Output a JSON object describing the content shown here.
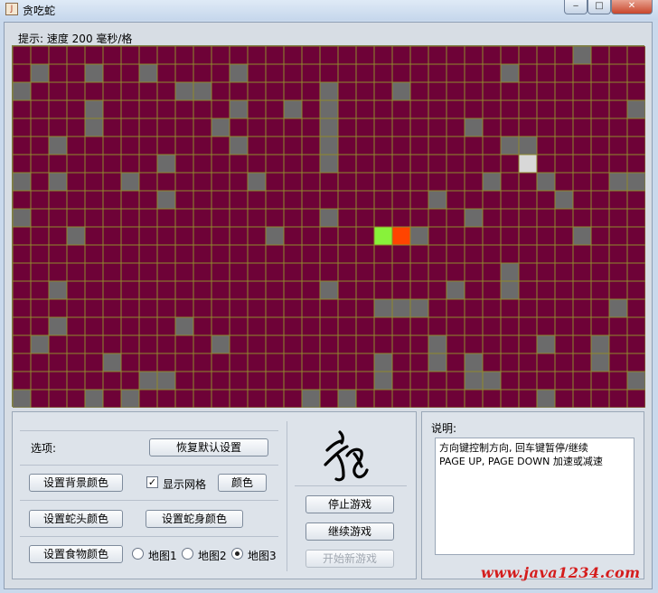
{
  "window": {
    "title": "贪吃蛇",
    "icon_label": "J",
    "controls": [
      "minimize-icon",
      "maximize-icon",
      "close-icon"
    ]
  },
  "hint": "提示: 速度 200 毫秒/格",
  "board": {
    "cols": 35,
    "rows": 20,
    "bg_color": "#6e0237",
    "grid_color": "#8f8a2c",
    "obstacle_color": "#6b6b6b",
    "food_color": "#d8d8d8",
    "head_color": "#ff4400",
    "body_color": "#88f23a",
    "snake_head": [
      21,
      10
    ],
    "snake_body": [
      [
        20,
        10
      ]
    ],
    "food": [
      28,
      6
    ],
    "obstacles": [
      [
        31,
        0
      ],
      [
        1,
        1
      ],
      [
        4,
        1
      ],
      [
        7,
        1
      ],
      [
        12,
        1
      ],
      [
        27,
        1
      ],
      [
        0,
        2
      ],
      [
        9,
        2
      ],
      [
        10,
        2
      ],
      [
        17,
        2
      ],
      [
        21,
        2
      ],
      [
        4,
        3
      ],
      [
        12,
        3
      ],
      [
        15,
        3
      ],
      [
        17,
        3
      ],
      [
        34,
        3
      ],
      [
        4,
        4
      ],
      [
        11,
        4
      ],
      [
        17,
        4
      ],
      [
        25,
        4
      ],
      [
        2,
        5
      ],
      [
        12,
        5
      ],
      [
        17,
        5
      ],
      [
        27,
        5
      ],
      [
        28,
        5
      ],
      [
        8,
        6
      ],
      [
        17,
        6
      ],
      [
        0,
        7
      ],
      [
        2,
        7
      ],
      [
        6,
        7
      ],
      [
        13,
        7
      ],
      [
        26,
        7
      ],
      [
        29,
        7
      ],
      [
        33,
        7
      ],
      [
        34,
        7
      ],
      [
        8,
        8
      ],
      [
        23,
        8
      ],
      [
        30,
        8
      ],
      [
        0,
        9
      ],
      [
        17,
        9
      ],
      [
        25,
        9
      ],
      [
        3,
        10
      ],
      [
        14,
        10
      ],
      [
        22,
        10
      ],
      [
        31,
        10
      ],
      [
        27,
        12
      ],
      [
        2,
        13
      ],
      [
        17,
        13
      ],
      [
        24,
        13
      ],
      [
        27,
        13
      ],
      [
        20,
        14
      ],
      [
        21,
        14
      ],
      [
        22,
        14
      ],
      [
        33,
        14
      ],
      [
        2,
        15
      ],
      [
        9,
        15
      ],
      [
        1,
        16
      ],
      [
        11,
        16
      ],
      [
        23,
        16
      ],
      [
        29,
        16
      ],
      [
        32,
        16
      ],
      [
        5,
        17
      ],
      [
        20,
        17
      ],
      [
        23,
        17
      ],
      [
        25,
        17
      ],
      [
        32,
        17
      ],
      [
        7,
        18
      ],
      [
        8,
        18
      ],
      [
        20,
        18
      ],
      [
        25,
        18
      ],
      [
        26,
        18
      ],
      [
        34,
        18
      ],
      [
        0,
        19
      ],
      [
        4,
        19
      ],
      [
        6,
        19
      ],
      [
        16,
        19
      ],
      [
        18,
        19
      ],
      [
        29,
        19
      ]
    ]
  },
  "controls": {
    "options_label": "选项:",
    "restore_defaults": "恢复默认设置",
    "set_bg_color": "设置背景颜色",
    "show_grid": "显示网格",
    "show_grid_checked": true,
    "color": "颜色",
    "set_head_color": "设置蛇头颜色",
    "set_body_color": "设置蛇身颜色",
    "set_food_color": "设置食物颜色",
    "map1": "地图1",
    "map2": "地图2",
    "map3": "地图3",
    "selected_map": "地图3",
    "stop_game": "停止游戏",
    "continue_game": "继续游戏",
    "new_game": "开始新游戏"
  },
  "description": {
    "title": "说明:",
    "line1": "方向键控制方向, 回车键暂停/继续",
    "line2": "PAGE UP, PAGE DOWN 加速或减速"
  },
  "watermark": "www.java1234.com"
}
